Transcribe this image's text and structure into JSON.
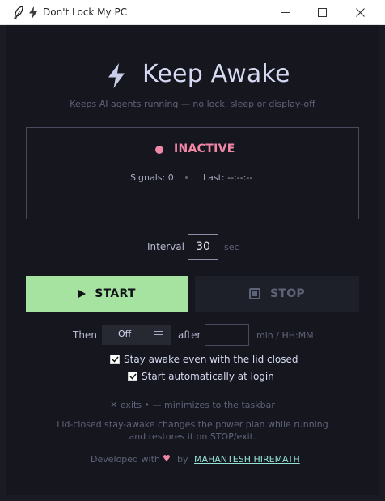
{
  "window": {
    "title": "Don't Lock My PC",
    "app_icon": "feather-icon",
    "title_icon": "bolt-icon",
    "controls": [
      "minimize-icon",
      "maximize-icon",
      "close-icon"
    ]
  },
  "hero": {
    "icon": "bolt-icon",
    "title": "Keep Awake",
    "subtitle": "Keeps AI agents running — no lock, sleep or display-off"
  },
  "status": {
    "state": "INACTIVE",
    "signals": "Signals: 0",
    "separator": "•",
    "last": "Last: --:--:--"
  },
  "interval": {
    "label": "Interval",
    "value": "30",
    "unit": "sec"
  },
  "buttons": {
    "start": "START",
    "stop": "STOP"
  },
  "schedule": {
    "then_label": "Then",
    "then_value": "Off",
    "after_label": "after",
    "after_value": "",
    "after_hint": "min / HH:MM"
  },
  "options": [
    {
      "label": "Stay awake even with the lid closed",
      "checked": true
    },
    {
      "label": "Start automatically at login",
      "checked": true
    }
  ],
  "hints": {
    "controls": "✕ exits  •  — minimizes to the taskbar",
    "lid_note": "Lid-closed stay-awake changes the power plan while running and restores it on STOP/exit."
  },
  "footer": {
    "developed_with": "Developed with",
    "heart": "♥",
    "by": "by",
    "author": "MAHANTESH HIREMATH"
  },
  "colors": {
    "background": "#15161e",
    "accent_green": "#a6e3a1",
    "inactive_pink": "#f087a7",
    "link_teal": "#94e2d5",
    "title": "#d5d9f2"
  }
}
